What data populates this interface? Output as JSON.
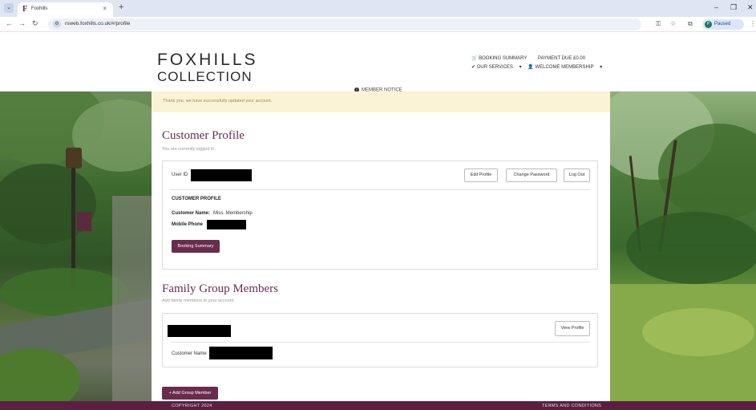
{
  "browser": {
    "tab_title": "Foxhills",
    "tab_favicon": "F",
    "url": "rsweb.foxhills.co.uk/#/profile",
    "paused_label": "Paused",
    "profile_initial": "P"
  },
  "header": {
    "logo_top": "FOXHILLS",
    "logo_bottom": "COLLECTION",
    "member_notice": "MEMBER NOTICE",
    "booking_summary": "BOOKING SUMMARY",
    "payment_due": "PAYMENT DUE £0.00",
    "our_services": "OUR SERVICES",
    "welcome": "WELCOME MEMBERSHIP"
  },
  "alert": {
    "text": "Thank you, we have successfully updated your account."
  },
  "profile": {
    "title": "Customer Profile",
    "subtitle": "You are currently logged in.",
    "user_id_label": "User ID",
    "edit_profile": "Edit Profile",
    "change_password": "Change Password",
    "log_out": "Log Out",
    "section_heading": "CUSTOMER PROFILE",
    "customer_name_label": "Customer Name:",
    "customer_name_value": "Miss. Membership",
    "mobile_phone_label": "Mobile Phone",
    "booking_summary_button": "Booking Summary"
  },
  "family": {
    "title": "Family Group Members",
    "subtitle": "Add family members to your account",
    "view_profile": "View Profile",
    "customer_name_label": "Customer Name",
    "add_member_button": "+ Add Group Member"
  },
  "footer": {
    "copyright": "COPYRIGHT 2024",
    "terms": "TERMS AND CONDITIONS"
  },
  "colors": {
    "brand_plum": "#6a2c4c",
    "footer": "#5c1f42",
    "alert_bg": "#fbf3d6"
  }
}
